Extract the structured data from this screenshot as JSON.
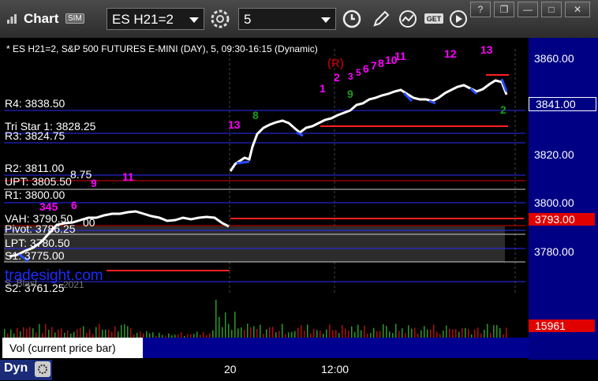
{
  "window": {
    "title": "Chart",
    "sim_badge": "SIM",
    "symbol": "ES H21=2",
    "interval": "5",
    "controls": [
      "minimize-icon",
      "restore-icon",
      "maximize-icon",
      "close-icon"
    ]
  },
  "toolbar_icons": [
    "settings-icon",
    "clock-icon",
    "pencil-icon",
    "indicator-icon",
    "get-icon",
    "play-icon"
  ],
  "chart_header": "* ES H21=2, S&P 500 FUTURES E-MINI (DAY), 5, 09:30-16:15 (Dynamic)",
  "price_axis": {
    "ticks": [
      "3860.00",
      "3840.00",
      "3820.00",
      "3800.00",
      "3780.00"
    ],
    "last_price": "3841.00",
    "marker_price": "3793.00",
    "colors": {
      "last": "#000084",
      "marker": "#e00000"
    }
  },
  "levels": [
    {
      "label": "R4: 3838.50"
    },
    {
      "label": "Tri Star 1: 3828.25"
    },
    {
      "label": "R3: 3824.75"
    },
    {
      "label": "R2: 3811.00"
    },
    {
      "label": "UPT: 3805.50"
    },
    {
      "label": "R1: 3800.00"
    },
    {
      "label": "VAH: 3790.50"
    },
    {
      "label": "Pivot: 3786.25"
    },
    {
      "label": "LPT: 3780.50"
    },
    {
      "label": "S1: 3775.00"
    },
    {
      "label": "S2: 3761.25"
    }
  ],
  "partial_labels": {
    "a": "8.75",
    "b": "00",
    "c": "2021",
    "d": "S. Blast"
  },
  "td_markers": {
    "magenta": [
      "1",
      "2",
      "3",
      "5",
      "6",
      "7",
      "8",
      "10",
      "11",
      "12",
      "13",
      "9",
      "11",
      "345",
      "6",
      "13"
    ],
    "green": [
      "8",
      "9",
      "2"
    ],
    "setup": "(R)"
  },
  "watermark": "tradesight.com",
  "volume": {
    "label": "Vol (current price bar)",
    "value": "15961",
    "value_color": "#e00000"
  },
  "x_axis": {
    "labels": [
      "20",
      "12:00"
    ]
  },
  "footer": {
    "mode": "Dyn"
  }
}
